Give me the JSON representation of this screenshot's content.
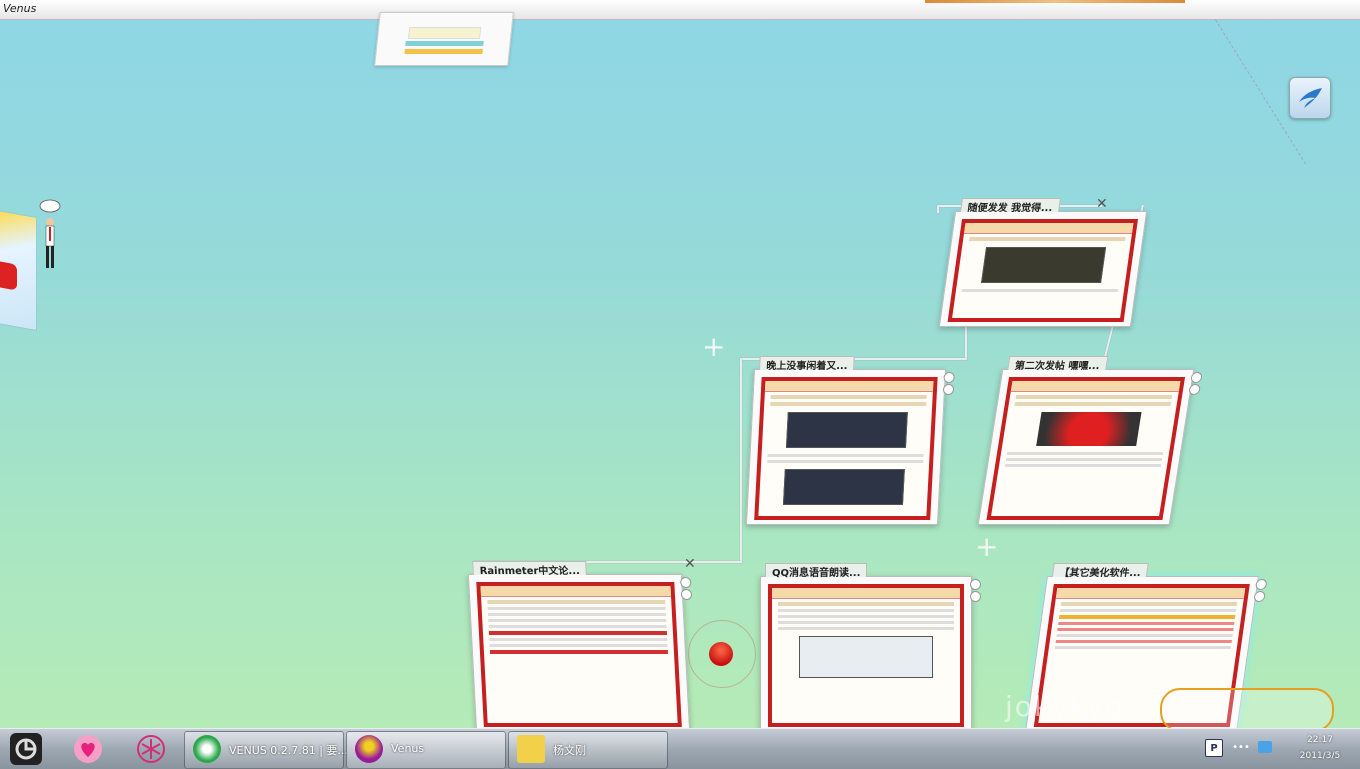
{
  "window": {
    "title": "Venus"
  },
  "cards": [
    {
      "label": "随便发发 我觉得..."
    },
    {
      "label": "晚上没事闲着又..."
    },
    {
      "label": "第二次发帖 嘿嘿..."
    },
    {
      "label": "Rainmeter中文论..."
    },
    {
      "label": "QQ消息语音朗读..."
    },
    {
      "label": "【其它美化软件..."
    }
  ],
  "watermark": {
    "text": "jokykyo"
  },
  "taskbar": {
    "tasks": [
      {
        "label": "VENUS 0.2.7.81 | 要...",
        "icon": "ie-icon"
      },
      {
        "label": "Venus",
        "icon": "venus-icon"
      },
      {
        "label": "杨文刚",
        "icon": "note-icon"
      }
    ],
    "clock": {
      "time": "22:17",
      "date": "2011/3/5"
    }
  },
  "colors": {
    "accent": "#c61f1f",
    "background_top": "#8fd6e6",
    "background_bottom": "#b8ecb4"
  }
}
